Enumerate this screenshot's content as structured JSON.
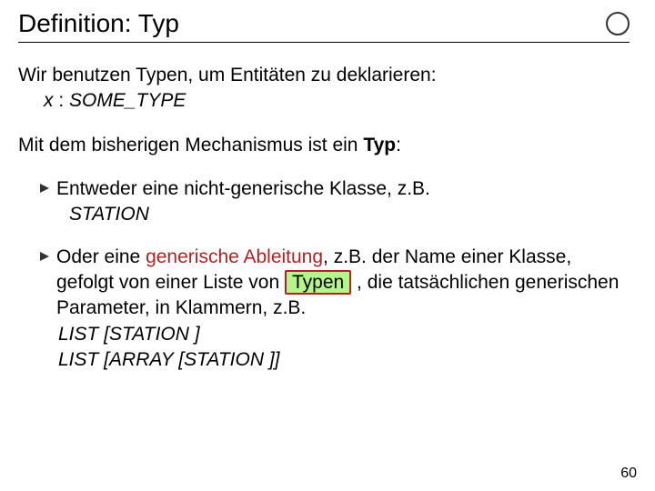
{
  "title": "Definition: Typ",
  "logo_text": "",
  "intro_line": "Wir benutzen Typen, um Entitäten zu deklarieren:",
  "intro_code_x": "x",
  "intro_code_sep": " : ",
  "intro_code_type": "SOME_TYPE",
  "mid_part1": "Mit dem bisherigen Mechanismus ist ein ",
  "mid_bold": "Typ",
  "mid_part2": ":",
  "bullet1_text": "Entweder eine nicht-generische Klasse, z.B.",
  "bullet1_code": "STATION",
  "bullet2_pre": "Oder eine ",
  "bullet2_gen": "generische Ableitung",
  "bullet2_mid1": ", z.B. der Name einer Klasse, gefolgt von einer Liste von ",
  "bullet2_hl": "Typen",
  "bullet2_mid2": " , die tatsächlichen generischen Parameter, in Klammern, z.B.",
  "bullet2_code1": "LIST  [STATION ]",
  "bullet2_code2": "LIST  [ARRAY [STATION ]]",
  "page_number": "60"
}
